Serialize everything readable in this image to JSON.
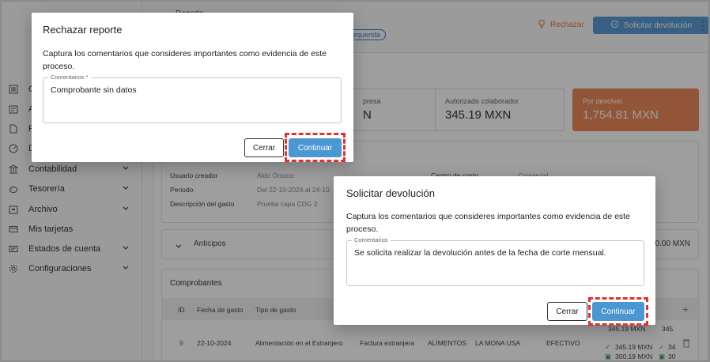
{
  "header": {
    "title_partial": "Reporte ...",
    "status_badge": "requerida",
    "reject_label": "Rechazar",
    "solicit_label": "Solicitar devolución"
  },
  "sidebar": {
    "items": [
      {
        "label": "C",
        "icon": "list-icon",
        "expandable": false
      },
      {
        "label": "A",
        "icon": "doc-icon",
        "expandable": false
      },
      {
        "label": "R",
        "icon": "file-icon",
        "expandable": false
      },
      {
        "label": "D",
        "icon": "gauge-icon",
        "expandable": false
      },
      {
        "label": "Contabilidad",
        "icon": "bank-icon",
        "expandable": true
      },
      {
        "label": "Tesorería",
        "icon": "piggy-icon",
        "expandable": true
      },
      {
        "label": "Archivo",
        "icon": "archive-icon",
        "expandable": true
      },
      {
        "label": "Mis tarjetas",
        "icon": "card-icon",
        "expandable": false
      },
      {
        "label": "Estados de cuenta",
        "icon": "statement-icon",
        "expandable": true
      },
      {
        "label": "Configuraciones",
        "icon": "gear-icon",
        "expandable": true
      }
    ]
  },
  "stats": [
    {
      "label": "presa",
      "value": "N"
    },
    {
      "label": "Autorizado colaborador",
      "value": "345.19 MXN"
    },
    {
      "label": "Por devolver",
      "value": "1,754.81 MXN"
    }
  ],
  "info": {
    "creator_label": "Usuario creador",
    "creator_value": "Aldo Orozco",
    "period_label": "Periodo",
    "period_value": "Del 22-10-2024 al 24-10",
    "desc_label": "Descripción del gasto",
    "desc_value": "Prueba capa CDG 2",
    "cost_center_label": "Centro de costo",
    "cost_center_value": "Comercial"
  },
  "anticipos": {
    "label": "Anticipos",
    "amount": "0.00 MXN"
  },
  "comprobantes": {
    "title": "Comprobantes",
    "columns": [
      "ID",
      "Fecha de gasto",
      "Tipo de gasto"
    ],
    "row": {
      "id": "9",
      "date": "22-10-2024",
      "type": "Alimentación en el Extranjero",
      "invoice": "Factura extranjera",
      "category": "ALIMENTOS",
      "vendor": "LA MONA USA",
      "payment": "EFECTIVO",
      "amount_top": "345.19 MXN",
      "amount_top2": "345",
      "amount_1": "345.19 MXN",
      "amount_1b": "34",
      "amount_2": "300.19 MXN",
      "amount_2b": "30"
    }
  },
  "modal_reject": {
    "title": "Rechazar reporte",
    "description": "Captura los comentarios que consideres importantes como evidencia de este proceso.",
    "field_label": "Comentarios *",
    "field_value": "Comprobante sin datos",
    "close_label": "Cerrar",
    "continue_label": "Continuar"
  },
  "modal_solicit": {
    "title": "Solicitar devolución",
    "description": "Captura los comentarios que consideres importantes como evidencia de este proceso.",
    "field_label": "Comentarios",
    "field_value": "Se solicita realizar la devolución antes de la fecha de corte mensual.",
    "close_label": "Cerrar",
    "continue_label": "Continuar"
  },
  "colors": {
    "primary": "#4a97d1",
    "orange": "#ee8a5b",
    "highlight": "#e03131"
  }
}
